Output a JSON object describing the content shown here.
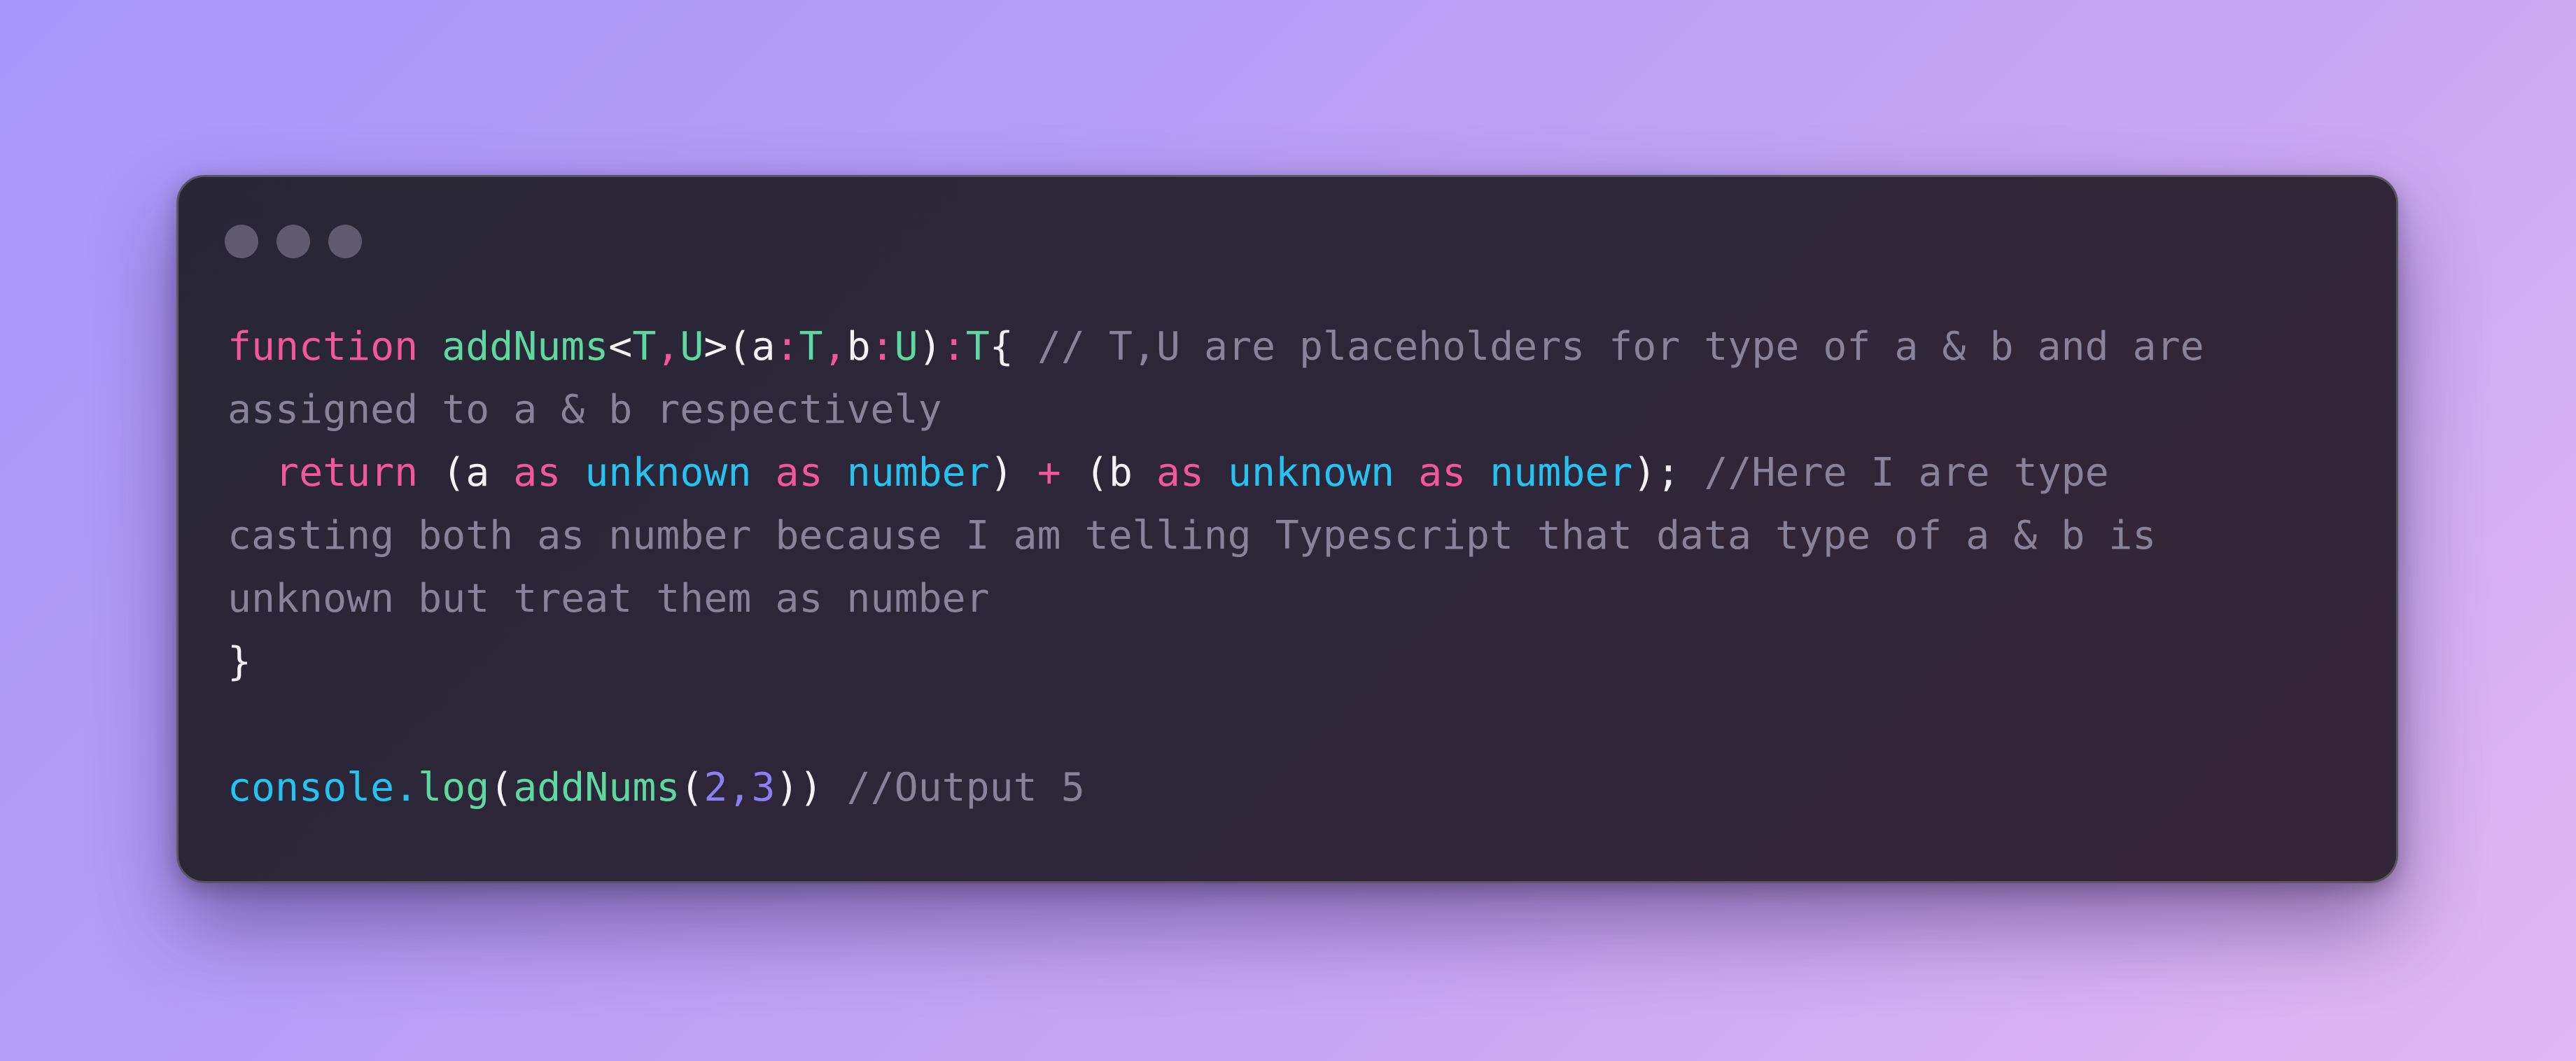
{
  "window": {
    "controls": [
      "window-dot",
      "window-dot",
      "window-dot"
    ]
  },
  "code": {
    "line1": {
      "kw_function": "function",
      "fn_name": "addNums",
      "lt": "<",
      "tparam_T": "T",
      "comma1": ",",
      "tparam_U": "U",
      "gt_paren": ">(",
      "param_a": "a",
      "colon1": ":",
      "type_T1": "T",
      "comma2": ",",
      "param_b": "b",
      "colon2": ":",
      "type_U": "U",
      "rparen": ")",
      "colon3": ":",
      "type_T2": "T",
      "lbrace": "{",
      "comment": " // T,U are placeholders for type of a & b and are"
    },
    "line2": {
      "comment": "assigned to a & b respectively"
    },
    "line3": {
      "kw_return": "return",
      "lparen1": "(a",
      "as1": "as",
      "unknown1": "unknown",
      "as2": "as",
      "number1": "number",
      "rparen1": ")",
      "plus": "+",
      "lparen2": "(b",
      "as3": "as",
      "unknown2": "unknown",
      "as4": "as",
      "number2": "number",
      "end": ");",
      "comment": " //Here I are type"
    },
    "line4": {
      "comment": "casting both as number because I am telling Typescript that data type of a & b is"
    },
    "line5": {
      "comment": "unknown but treat them as number"
    },
    "line6": {
      "rbrace": "}"
    },
    "line8": {
      "console": "console",
      "dot": ".",
      "log": "log",
      "lparen": "(",
      "fn_name": "addNums",
      "lparen2": "(",
      "arg1": "2",
      "comma": ",",
      "arg2": "3",
      "rparens": "))",
      "comment": " //Output 5"
    }
  },
  "colors": {
    "keyword": "#f2579a",
    "function": "#5fd8a0",
    "type": "#27c3f0",
    "number": "#8b7ff2",
    "comment": "#88839a",
    "plain": "#f4f2f8"
  }
}
